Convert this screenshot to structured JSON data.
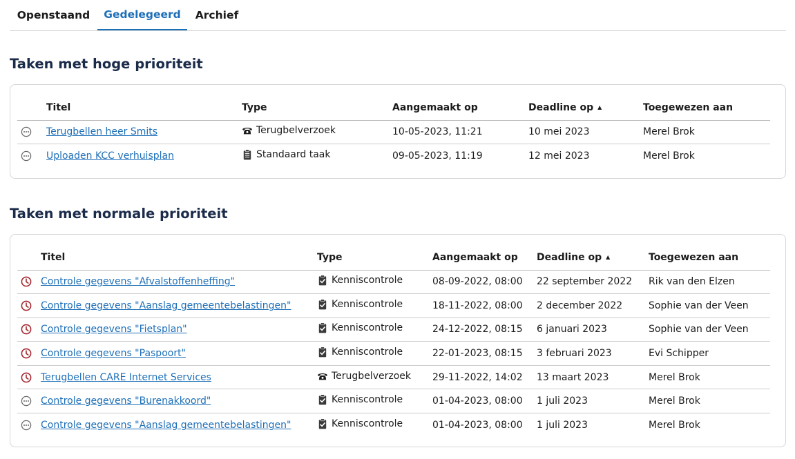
{
  "tabs": [
    {
      "label": "Openstaand",
      "active": false
    },
    {
      "label": "Gedelegeerd",
      "active": true
    },
    {
      "label": "Archief",
      "active": false
    }
  ],
  "sort_indicator": "▲",
  "high_priority": {
    "title": "Taken met hoge prioriteit",
    "columns": [
      "Titel",
      "Type",
      "Aangemaakt op",
      "Deadline op",
      "Toegewezen aan"
    ],
    "rows": [
      {
        "status_icon": "pending-icon",
        "title": "Terugbellen heer Smits",
        "type_icon": "phone-icon",
        "type": "Terugbelverzoek",
        "created": "10-05-2023, 11:21",
        "deadline": "10 mei 2023",
        "assignee": "Merel Brok"
      },
      {
        "status_icon": "pending-icon",
        "title": "Uploaden KCC verhuisplan",
        "type_icon": "clipboard-icon",
        "type": "Standaard taak",
        "created": "09-05-2023, 11:19",
        "deadline": "12 mei 2023",
        "assignee": "Merel Brok"
      }
    ]
  },
  "normal_priority": {
    "title": "Taken met normale prioriteit",
    "columns": [
      "Titel",
      "Type",
      "Aangemaakt op",
      "Deadline op",
      "Toegewezen aan"
    ],
    "rows": [
      {
        "status_icon": "overdue-clock-icon",
        "title": "Controle gegevens \"Afvalstoffenheffing\"",
        "type_icon": "clipboard-check-icon",
        "type": "Kenniscontrole",
        "created": "08-09-2022, 08:00",
        "deadline": "22 september 2022",
        "assignee": "Rik van den Elzen"
      },
      {
        "status_icon": "overdue-clock-icon",
        "title": "Controle gegevens \"Aanslag gemeentebelastingen\"",
        "type_icon": "clipboard-check-icon",
        "type": "Kenniscontrole",
        "created": "18-11-2022, 08:00",
        "deadline": "2 december 2022",
        "assignee": "Sophie van der Veen"
      },
      {
        "status_icon": "overdue-clock-icon",
        "title": "Controle gegevens \"Fietsplan\"",
        "type_icon": "clipboard-check-icon",
        "type": "Kenniscontrole",
        "created": "24-12-2022, 08:15",
        "deadline": "6 januari 2023",
        "assignee": "Sophie van der Veen"
      },
      {
        "status_icon": "overdue-clock-icon",
        "title": "Controle gegevens \"Paspoort\"",
        "type_icon": "clipboard-check-icon",
        "type": "Kenniscontrole",
        "created": "22-01-2023, 08:15",
        "deadline": "3 februari 2023",
        "assignee": "Evi Schipper"
      },
      {
        "status_icon": "overdue-clock-icon",
        "title": "Terugbellen CARE Internet Services",
        "type_icon": "phone-icon",
        "type": "Terugbelverzoek",
        "created": "29-11-2022, 14:02",
        "deadline": "13 maart 2023",
        "assignee": "Merel Brok"
      },
      {
        "status_icon": "pending-icon",
        "title": "Controle gegevens \"Burenakkoord\"",
        "type_icon": "clipboard-check-icon",
        "type": "Kenniscontrole",
        "created": "01-04-2023, 08:00",
        "deadline": "1 juli 2023",
        "assignee": "Merel Brok"
      },
      {
        "status_icon": "pending-icon",
        "title": "Controle gegevens \"Aanslag gemeentebelastingen\"",
        "type_icon": "clipboard-check-icon",
        "type": "Kenniscontrole",
        "created": "01-04-2023, 08:00",
        "deadline": "1 juli 2023",
        "assignee": "Merel Brok"
      }
    ]
  },
  "colors": {
    "link": "#1d6fb8",
    "overdue": "#a3282f",
    "pending": "#6b6b6b",
    "heading": "#1b2b4a"
  }
}
